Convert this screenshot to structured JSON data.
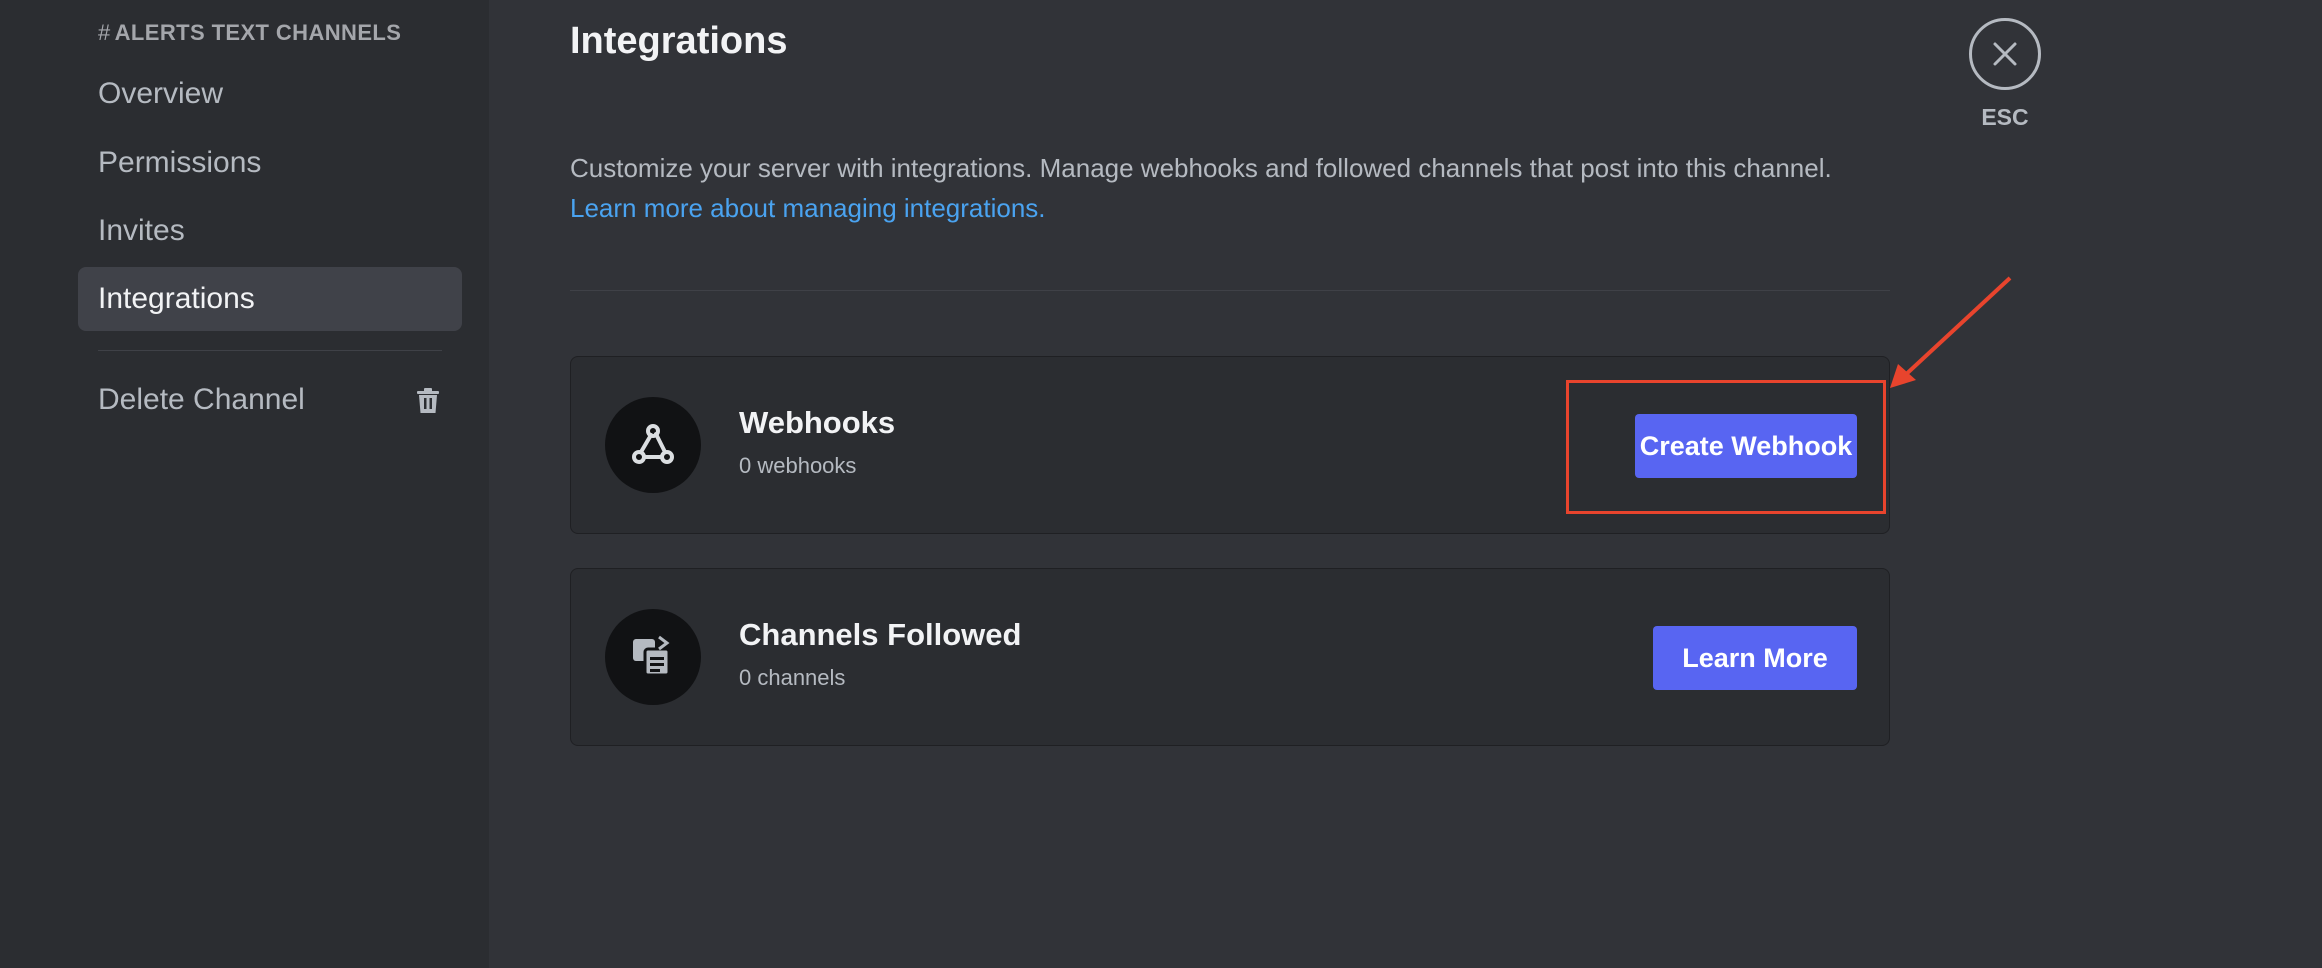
{
  "sidebar": {
    "header_hash": "#",
    "header_channel": "ALERTS",
    "header_suffix": "TEXT CHANNELS",
    "items": [
      {
        "label": "Overview"
      },
      {
        "label": "Permissions"
      },
      {
        "label": "Invites"
      },
      {
        "label": "Integrations",
        "active": true
      }
    ],
    "delete_label": "Delete Channel"
  },
  "main": {
    "title": "Integrations",
    "description": "Customize your server with integrations. Manage webhooks and followed channels that post into this channel.",
    "link_text": "Learn more about managing integrations.",
    "cards": [
      {
        "icon": "webhook-icon",
        "title": "Webhooks",
        "subtitle": "0 webhooks",
        "button_label": "Create Webhook"
      },
      {
        "icon": "channels-followed-icon",
        "title": "Channels Followed",
        "subtitle": "0 channels",
        "button_label": "Learn More"
      }
    ]
  },
  "close": {
    "label": "ESC",
    "icon": "close-icon"
  },
  "colors": {
    "background": "#313338",
    "sidebar": "#2b2d31",
    "accent_button": "#5865f2",
    "link": "#4aa3f0",
    "annotation": "#e8442d"
  }
}
